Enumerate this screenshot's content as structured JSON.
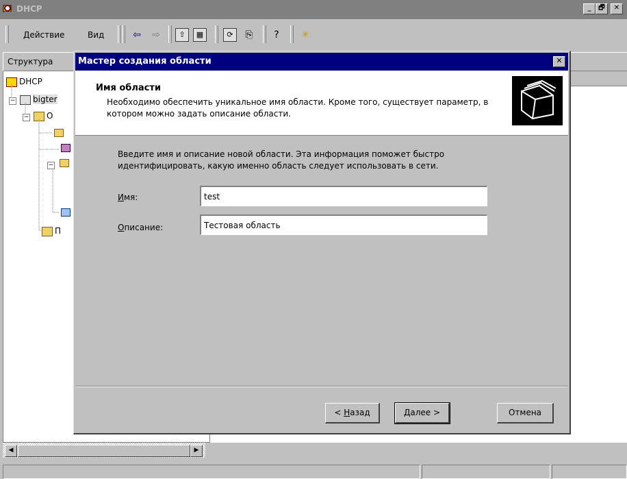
{
  "window": {
    "title": "DHCP",
    "controls": [
      "_",
      "🗗",
      "✕"
    ]
  },
  "toolbar": {
    "action_label": "Действие",
    "view_label": "Вид"
  },
  "tree": {
    "header": "Структура",
    "items": [
      {
        "label": "DHCP"
      },
      {
        "label": "bigter"
      },
      {
        "label": "О"
      },
      {
        "label": "П"
      }
    ]
  },
  "dialog": {
    "title": "Мастер создания области",
    "close": "✕",
    "header": {
      "title": "Имя области",
      "description": "Необходимо обеспечить уникальное имя области. Кроме того, существует параметр, в котором можно задать описание области."
    },
    "body_text": "Введите имя и описание новой области. Эта информация поможет быстро идентифицировать, какую именно область следует использовать в сети.",
    "name_field": {
      "label_underlined": "И",
      "label_rest": "мя:",
      "value": "test"
    },
    "description_field": {
      "label_underlined": "О",
      "label_rest": "писание:",
      "value": "Тестовая область"
    },
    "buttons": {
      "back_prefix": "< ",
      "back_underlined": "Н",
      "back_rest": "азад",
      "next": "Далее >",
      "cancel": "Отмена"
    }
  },
  "scrollbar": {
    "left": "◀",
    "right": "▶"
  },
  "colors": {
    "dialog_title_bg": "#000080",
    "window_bg": "#c0c0c0",
    "inactive_title": "#808080"
  }
}
